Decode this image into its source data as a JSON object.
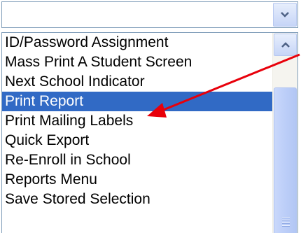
{
  "dropdown": {
    "selected_value": ""
  },
  "listbox": {
    "items": [
      {
        "label": "ID/Password Assignment",
        "selected": false
      },
      {
        "label": "Mass Print A Student Screen",
        "selected": false
      },
      {
        "label": "Next School Indicator",
        "selected": false
      },
      {
        "label": "Print Report",
        "selected": true
      },
      {
        "label": "Print Mailing Labels",
        "selected": false
      },
      {
        "label": "Quick Export",
        "selected": false
      },
      {
        "label": "Re-Enroll in School",
        "selected": false
      },
      {
        "label": "Reports Menu",
        "selected": false
      },
      {
        "label": "Save Stored Selection",
        "selected": false
      }
    ]
  },
  "icons": {
    "dropdown_arrow": "chevron-down-icon",
    "scroll_up": "chevron-up-icon",
    "thumb_grip": "grip-icon",
    "annotation": "red-arrow-annotation"
  },
  "colors": {
    "selection": "#316ac5",
    "annotation": "#e8000b",
    "scroll_button": "#c6d5f7"
  }
}
